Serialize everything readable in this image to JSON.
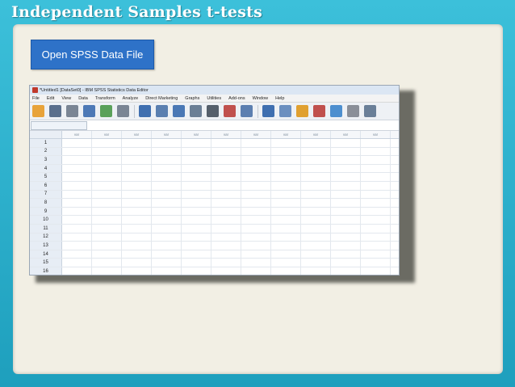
{
  "slide": {
    "title": "Independent Samples t-tests",
    "button_label": "Open SPSS Data File"
  },
  "spss": {
    "window_title": "*Untitled1 [DataSet0] - IBM SPSS Statistics Data Editor",
    "menu": [
      "File",
      "Edit",
      "View",
      "Data",
      "Transform",
      "Analyze",
      "Direct Marketing",
      "Graphs",
      "Utilities",
      "Add-ons",
      "Window",
      "Help"
    ],
    "toolbar_icons": [
      {
        "name": "open-folder-icon",
        "color": "#e8a33a"
      },
      {
        "name": "save-icon",
        "color": "#5a6f8c"
      },
      {
        "name": "print-icon",
        "color": "#7a8594"
      },
      {
        "name": "dialog-recall-icon",
        "color": "#4d79b6"
      },
      {
        "name": "undo-icon",
        "color": "#5aa15a"
      },
      {
        "name": "redo-icon",
        "color": "#7a8594"
      },
      {
        "name": "goto-case-icon",
        "color": "#3f6fb0"
      },
      {
        "name": "goto-variable-icon",
        "color": "#5a7fb0"
      },
      {
        "name": "variables-icon",
        "color": "#4a78b5"
      },
      {
        "name": "split-file-icon",
        "color": "#6b7f95"
      },
      {
        "name": "find-icon",
        "color": "#555f6b"
      },
      {
        "name": "insert-cases-icon",
        "color": "#c0504d"
      },
      {
        "name": "insert-variable-icon",
        "color": "#5c7fb0"
      },
      {
        "name": "split-data-icon",
        "color": "#3f6fb0"
      },
      {
        "name": "weight-cases-icon",
        "color": "#6b8fbf"
      },
      {
        "name": "select-cases-icon",
        "color": "#e0a030"
      },
      {
        "name": "value-labels-icon",
        "color": "#c0504d"
      },
      {
        "name": "use-sets-icon",
        "color": "#4d8fcf"
      },
      {
        "name": "show-all-icon",
        "color": "#8a8f98"
      },
      {
        "name": "spelling-icon",
        "color": "#6a7f98"
      }
    ],
    "column_header": "var",
    "column_count": 11,
    "rows": [
      "1",
      "2",
      "3",
      "4",
      "5",
      "6",
      "7",
      "8",
      "9",
      "10",
      "11",
      "12",
      "13",
      "14",
      "15",
      "16"
    ]
  }
}
